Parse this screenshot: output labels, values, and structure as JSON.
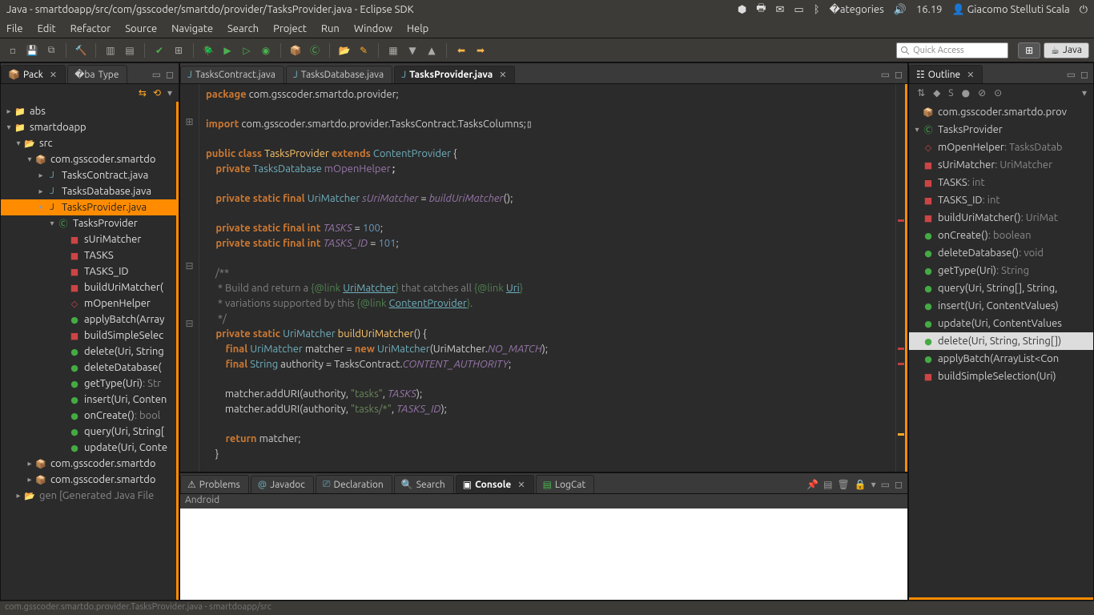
{
  "os": {
    "title": "Java - smartdoapp/src/com/gsscoder/smartdo/provider/TasksProvider.java - Eclipse SDK",
    "time": "16.19",
    "user": "Giacomo Stelluti Scala"
  },
  "menu": [
    "File",
    "Edit",
    "Refactor",
    "Source",
    "Navigate",
    "Search",
    "Project",
    "Run",
    "Window",
    "Help"
  ],
  "quick_access_placeholder": "Quick Access",
  "perspective_java": "Java",
  "left_tabs": {
    "pack": "Pack",
    "type": "Type"
  },
  "package_tree": {
    "abs": "abs",
    "smartdoapp": "smartdoapp",
    "src": "src",
    "pkg": "com.gsscoder.smartdo",
    "tc": "TasksContract.java",
    "tdb": "TasksDatabase.java",
    "tp": "TasksProvider.java",
    "cls": "TasksProvider",
    "m_sUriMatcher": "sUriMatcher",
    "m_TASKS": "TASKS",
    "m_TASKS_ID": "TASKS_ID",
    "m_buildUriMatcher": "buildUriMatcher(",
    "m_mOpenHelper": "mOpenHelper",
    "m_applyBatch": "applyBatch(Array",
    "m_buildSimple": "buildSimpleSelec",
    "m_delete": "delete(Uri, String",
    "m_deleteDatabase": "deleteDatabase(",
    "m_getType": "getType(Uri)",
    "m_getType_t": " : Str",
    "m_insert": "insert(Uri, Conten",
    "m_onCreate": "onCreate()",
    "m_onCreate_t": " : bool",
    "m_query": "query(Uri, String[",
    "m_update": "update(Uri, Conte",
    "pkg2": "com.gsscoder.smartdo",
    "pkg3": "com.gsscoder.smartdo",
    "gen": "gen",
    "gen_t": " [Generated Java File"
  },
  "editor_tabs": {
    "t1": "TasksContract.java",
    "t2": "TasksDatabase.java",
    "t3": "TasksProvider.java"
  },
  "code": {
    "l1a": "package",
    "l1b": " com.gsscoder.smartdo.provider;",
    "l3a": "import",
    "l3b": " com.gsscoder.smartdo.provider.TasksContract.TasksColumns;",
    "l5a": "public ",
    "l5b": "class ",
    "l5c": "TasksProvider ",
    "l5d": "extends ",
    "l5e": "ContentProvider ",
    "l5f": "{",
    "l6a": "    private ",
    "l6b": "TasksDatabase ",
    "l6c": "mOpenHelper",
    ";": "",
    "l8a": "    private static final ",
    "l8b": "UriMatcher ",
    "l8c": "sUriMatcher ",
    "l8d": "= ",
    "l8e": "buildUriMatcher",
    "l8f": "();",
    "l10a": "    private static final int ",
    "l10b": "TASKS ",
    "l10c": "= ",
    "l10d": "100",
    "l10e": ";",
    "l11a": "    private static final int ",
    "l11b": "TASKS_ID ",
    "l11c": "= ",
    "l11d": "101",
    "l11e": ";",
    "c1": "    /**",
    "c2": "     * Build and return a ",
    "c2a": "{@link ",
    "c2b": "UriMatcher",
    "c2c": "}",
    "c2d": " that catches all ",
    "c2e": "{@link ",
    "c2f": "Uri",
    "c2g": "}",
    "c3": "     * variations supported by this ",
    "c3a": "{@link ",
    "c3b": "ContentProvider",
    "c3c": "}",
    "c3d": ".",
    "c4": "     */",
    "l15a": "    private static ",
    "l15b": "UriMatcher ",
    "l15c": "buildUriMatcher",
    "l15d": "() {",
    "l16a": "        final ",
    "l16b": "UriMatcher ",
    "l16c": "matcher ",
    "l16d": "= ",
    "l16e": "new ",
    "l16f": "UriMatcher",
    "l16g": "(UriMatcher.",
    "l16h": "NO_MATCH",
    "l16i": ");",
    "l17a": "        final ",
    "l17b": "String ",
    "l17c": "authority ",
    "l17d": "= ",
    "l17e": "TasksContract.",
    "l17f": "CONTENT_AUTHORITY",
    "l17g": ";",
    "l19a": "        matcher.addURI(authority, ",
    "l19b": "\"tasks\"",
    "l19c": ", ",
    "l19d": "TASKS",
    "l19e": ");",
    "l20a": "        matcher.addURI(authority, ",
    "l20b": "\"tasks/*\"",
    "l20c": ", ",
    "l20d": "TASKS_ID",
    "l20e": ");",
    "l22a": "        return ",
    "l22b": "matcher;",
    "l23": "    }"
  },
  "bottom_tabs": {
    "problems": "Problems",
    "javadoc": "Javadoc",
    "declaration": "Declaration",
    "search": "Search",
    "console": "Console",
    "logcat": "LogCat"
  },
  "console_header": "Android",
  "outline_title": "Outline",
  "outline": {
    "pkg": "com.gsscoder.smartdo.prov",
    "cls": "TasksProvider",
    "mOpenHelper": "mOpenHelper",
    "mOpenHelper_t": " : TasksDatab",
    "sUriMatcher": "sUriMatcher",
    "sUriMatcher_t": " : UriMatcher",
    "TASKS": "TASKS",
    "TASKS_t": " : int",
    "TASKS_ID": "TASKS_ID",
    "TASKS_ID_t": " : int",
    "buildUriMatcher": "buildUriMatcher()",
    "buildUriMatcher_t": " : UriMat",
    "onCreate": "onCreate()",
    "onCreate_t": " : boolean",
    "deleteDatabase": "deleteDatabase()",
    "deleteDatabase_t": " : void",
    "getType": "getType(Uri)",
    "getType_t": " : String",
    "query": "query(Uri, String[], String,",
    "insert": "insert(Uri, ContentValues)",
    "update": "update(Uri, ContentValues",
    "delete": "delete(Uri, String, String[])",
    "applyBatch": "applyBatch(ArrayList<Con",
    "buildSimple": "buildSimpleSelection(Uri)"
  },
  "status": "com.gsscoder.smartdo.provider.TasksProvider.java - smartdoapp/src"
}
